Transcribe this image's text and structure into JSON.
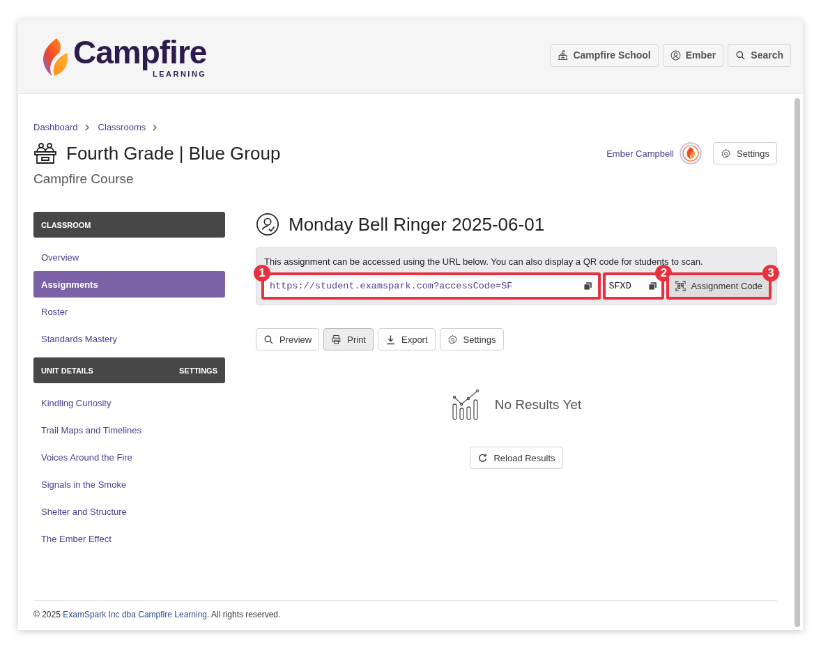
{
  "header": {
    "logo": {
      "wordmark": "Campfire",
      "tagline": "LEARNING"
    },
    "buttons": [
      {
        "kind": "school",
        "label": "Campfire School"
      },
      {
        "kind": "user",
        "label": "Ember"
      },
      {
        "kind": "search",
        "label": "Search"
      }
    ]
  },
  "breadcrumb": [
    "Dashboard",
    "Classrooms"
  ],
  "classroom": {
    "title": "Fourth Grade | Blue Group",
    "subtitle": "Campfire Course",
    "teacher": "Ember Campbell",
    "settings_button": "Settings"
  },
  "sidebar": [
    {
      "heading": "CLASSROOM",
      "items": [
        {
          "label": "Overview",
          "selected": false
        },
        {
          "label": "Assignments",
          "selected": true
        },
        {
          "label": "Roster",
          "selected": false
        },
        {
          "label": "Standards Mastery",
          "selected": false
        }
      ]
    },
    {
      "heading": "UNIT DETAILS",
      "action": "SETTINGS",
      "items": [
        {
          "label": "Kindling Curiosity",
          "selected": false
        },
        {
          "label": "Trail Maps and Timelines",
          "selected": false
        },
        {
          "label": "Voices Around the Fire",
          "selected": false
        },
        {
          "label": "Signals in the Smoke",
          "selected": false
        },
        {
          "label": "Shelter and Structure",
          "selected": false
        },
        {
          "label": "The Ember Effect",
          "selected": false
        }
      ]
    }
  ],
  "assignment": {
    "title": "Monday Bell Ringer 2025-06-01",
    "notice": "This assignment can be accessed using the URL below. You can also display a QR code for students to scan.",
    "url": "https://student.examspark.com?accessCode=SF",
    "code": "SFXD",
    "code_button": "Assignment Code",
    "toolbar": [
      {
        "kind": "preview",
        "label": "Preview",
        "selected": false
      },
      {
        "kind": "print",
        "label": "Print",
        "selected": true
      },
      {
        "kind": "export",
        "label": "Export",
        "selected": false
      },
      {
        "kind": "settings",
        "label": "Settings",
        "selected": false
      }
    ]
  },
  "results": {
    "empty_text": "No Results Yet",
    "reload_button": "Reload Results"
  },
  "callouts": {
    "url_field": "1",
    "code_field": "2",
    "code_button": "3"
  },
  "footer": {
    "prefix": "© 2025",
    "link": "ExamSpark Inc dba Campfire Learning",
    "suffix": ". All rights reserved."
  }
}
